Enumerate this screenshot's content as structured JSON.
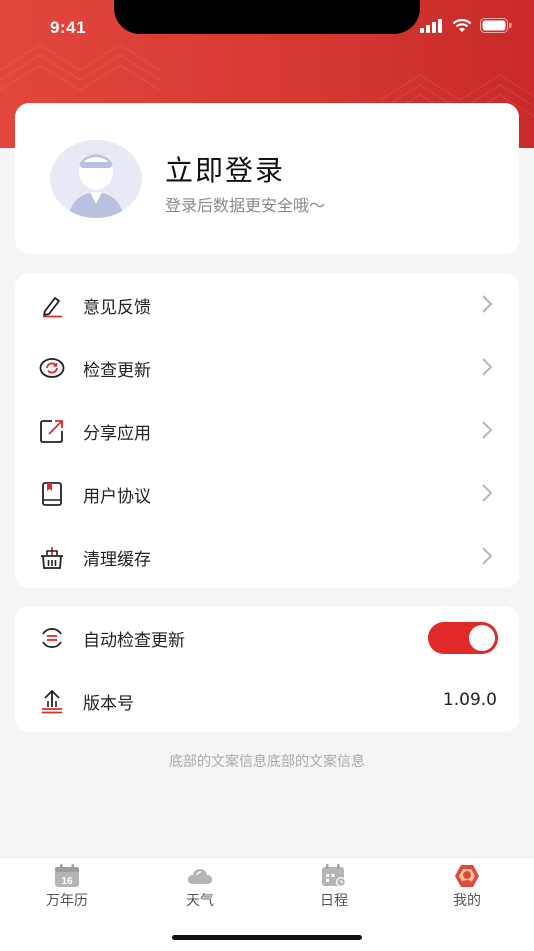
{
  "status_bar": {
    "time": "9:41"
  },
  "login": {
    "title": "立即登录",
    "subtitle": "登录后数据更安全哦～"
  },
  "menu": {
    "items": [
      {
        "label": "意见反馈",
        "icon": "edit-icon"
      },
      {
        "label": "检查更新",
        "icon": "refresh-icon"
      },
      {
        "label": "分享应用",
        "icon": "share-icon"
      },
      {
        "label": "用户协议",
        "icon": "book-icon"
      },
      {
        "label": "清理缓存",
        "icon": "basket-icon"
      }
    ]
  },
  "settings": {
    "auto_update_label": "自动检查更新",
    "auto_update_enabled": true,
    "version_label": "版本号",
    "version_value": "1.09.0"
  },
  "footer": {
    "text": "底部的文案信息底部的文案信息"
  },
  "tabs": [
    {
      "label": "万年历",
      "icon": "calendar-icon",
      "badge": "16",
      "active": false
    },
    {
      "label": "天气",
      "icon": "cloud-icon",
      "active": false
    },
    {
      "label": "日程",
      "icon": "schedule-icon",
      "active": false
    },
    {
      "label": "我的",
      "icon": "profile-icon",
      "active": true
    }
  ],
  "colors": {
    "brand": "#d83a33",
    "accent_red": "#e02a2a",
    "background": "#f5f5f5",
    "text_secondary": "#8a8a8a"
  }
}
